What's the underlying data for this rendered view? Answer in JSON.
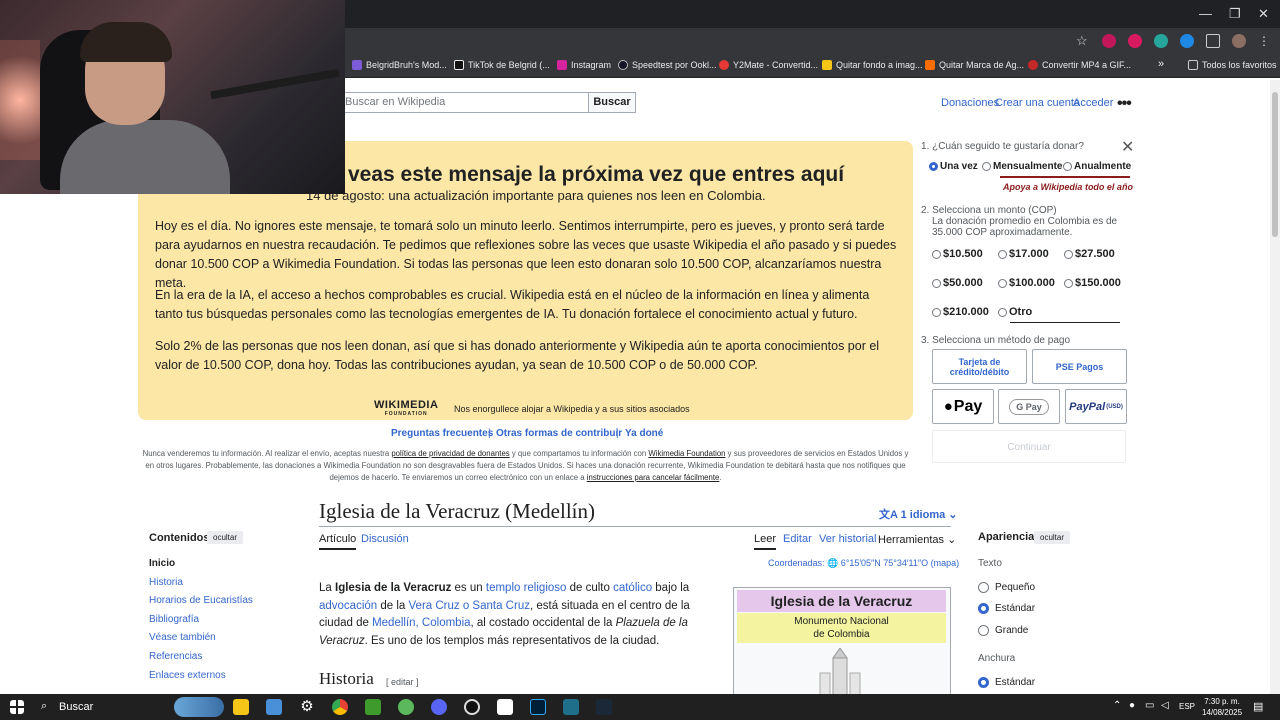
{
  "bookmarks": [
    {
      "label": "BelgridBruh's Mod...",
      "color": "#7b5cd6"
    },
    {
      "label": "TikTok de Belgrid (...",
      "color": "#000000"
    },
    {
      "label": "Instagram",
      "color": "#d6249f"
    },
    {
      "label": "Speedtest por Ookl...",
      "color": "#141526"
    },
    {
      "label": "Y2Mate - Convertid...",
      "color": "#e53935"
    },
    {
      "label": "Quitar fondo a imag...",
      "color": "#f5c518"
    },
    {
      "label": "Quitar Marca de Ag...",
      "color": "#ff6d00"
    },
    {
      "label": "Convertir MP4 a GIF...",
      "color": "#c62828"
    }
  ],
  "bookmarks_more": "»",
  "all_bookmarks": "Todos los favoritos",
  "wiki_header": {
    "search_placeholder": "Buscar en Wikipedia",
    "search_button": "Buscar",
    "donate": "Donaciones",
    "create_account": "Crear una cuenta",
    "login": "Acceder",
    "more": "•••"
  },
  "banner": {
    "title": "veas este mensaje la próxima vez que entres aquí",
    "subtitle": "14 de agosto: una actualización importante para quienes nos leen en Colombia.",
    "p1": "Hoy es el día. No ignores este mensaje, te tomará solo un minuto leerlo. Sentimos interrumpirte, pero es jueves, y pronto será tarde para ayudarnos en nuestra recaudación. Te pedimos que reflexiones sobre las veces que usaste Wikipedia el año pasado y si puedes donar 10.500 COP a Wikimedia Foundation. Si todas las personas que leen esto donaran solo 10.500 COP, alcanzaríamos nuestra meta.",
    "p2": "En la era de la IA, el acceso a hechos comprobables es crucial. Wikipedia está en el núcleo de la información en línea y alimenta tanto tus búsquedas personales como las tecnologías emergentes de IA. Tu donación fortalece el conocimiento actual y futuro.",
    "p3": "Solo 2% de las personas que nos leen donan, así que si has donado anteriormente y Wikipedia aún te aporta conocimientos por el valor de 10.500 COP, dona hoy. Todas las contribuciones ayudan, ya sean de 10.500 COP o de 50.000 COP.",
    "logo_top": "WIKIMEDIA",
    "logo_bottom": "FOUNDATION",
    "tagline": "Nos enorgullece alojar a Wikipedia y a sus sitios asociados"
  },
  "donation": {
    "step1": "1. ¿Cuán seguido te gustaría donar?",
    "freq": [
      "Una vez",
      "Mensualmente",
      "Anualmente"
    ],
    "apoya": "Apoya a Wikipedia todo el año",
    "step2": "2. Selecciona un monto (COP)",
    "step2_note1": "La donación promedio en Colombia es de",
    "step2_note2": "35.000 COP aproximadamente.",
    "amounts": [
      "$10.500",
      "$17.000",
      "$27.500",
      "$50.000",
      "$100.000",
      "$150.000",
      "$210.000",
      "Otro"
    ],
    "step3": "3. Selecciona un método de pago",
    "pay_card": "Tarjeta de crédito/débito",
    "pay_pse": "PSE Pagos",
    "pay_apple": "Pay",
    "pay_gpay": "G Pay",
    "pay_paypal": "PayPal",
    "pay_paypal_usd": "(USD)",
    "continue": "Continuar",
    "close": "✕"
  },
  "faq": {
    "faq": "Preguntas frecuentes",
    "other": "Otras formas de contribuir",
    "done": "Ya doné",
    "sep": "|"
  },
  "privacy": {
    "t1": "Nunca venderemos tu información. Al realizar el envío, aceptas nuestra ",
    "l1": "política de privacidad de donantes",
    "t2": " y que compartamos tu información con ",
    "l2": "Wikimedia Foundation",
    "t3": " y sus proveedores de servicios en Estados Unidos y en otros lugares. Probablemente, las donaciones a Wikimedia Foundation no son desgravables fuera de Estados Unidos. Si haces una donación recurrente, Wikimedia Foundation te debitará hasta que nos notifiques que dejemos de hacerlo. Te enviaremos un correo electrónico con un enlace a ",
    "l3": "instrucciones para cancelar fácilmente",
    "t4": "."
  },
  "article": {
    "title": "Iglesia de la Veracruz (Medellín)",
    "lang": "1 idioma",
    "tabs": [
      "Artículo",
      "Discusión"
    ],
    "actions": [
      "Leer",
      "Editar",
      "Ver historial",
      "Herramientas"
    ],
    "coords": "Coordenadas: 🌐 6°15′05″N 75°34′11″O (mapa)",
    "intro": {
      "a": "La ",
      "b": "Iglesia de la Veracruz",
      "c": " es un ",
      "l1": "templo religioso",
      "d": " de culto ",
      "l2": "católico",
      "e": " bajo la ",
      "l3": "advocación",
      "f": " de la ",
      "l4": "Vera Cruz o Santa Cruz",
      "g": ", está situada en el centro de la ciudad de ",
      "l5": "Medellín, Colombia",
      "h": ", al costado occidental de la ",
      "i": "Plazuela de la Veracruz",
      "j": ". Es uno de los templos más representativos de la ciudad."
    },
    "history": "Historia",
    "history_edit": "[ editar ]",
    "infobox_title": "Iglesia de la Veracruz",
    "infobox_sub1": "Monumento Nacional",
    "infobox_sub2": "de Colombia"
  },
  "toc": {
    "heading": "Contenidos",
    "hide": "ocultar",
    "items": [
      "Inicio",
      "Historia",
      "Horarios de Eucaristías",
      "Bibliografía",
      "Véase también",
      "Referencias",
      "Enlaces externos"
    ]
  },
  "appearance": {
    "heading": "Apariencia",
    "hide": "ocultar",
    "text_label": "Texto",
    "sizes": [
      "Pequeño",
      "Estándar",
      "Grande"
    ],
    "width_label": "Anchura",
    "width_opts": [
      "Estándar"
    ]
  },
  "taskbar": {
    "search": "Buscar",
    "time": "7:30 p. m.",
    "date": "14/08/2025",
    "lang": "ESP"
  }
}
